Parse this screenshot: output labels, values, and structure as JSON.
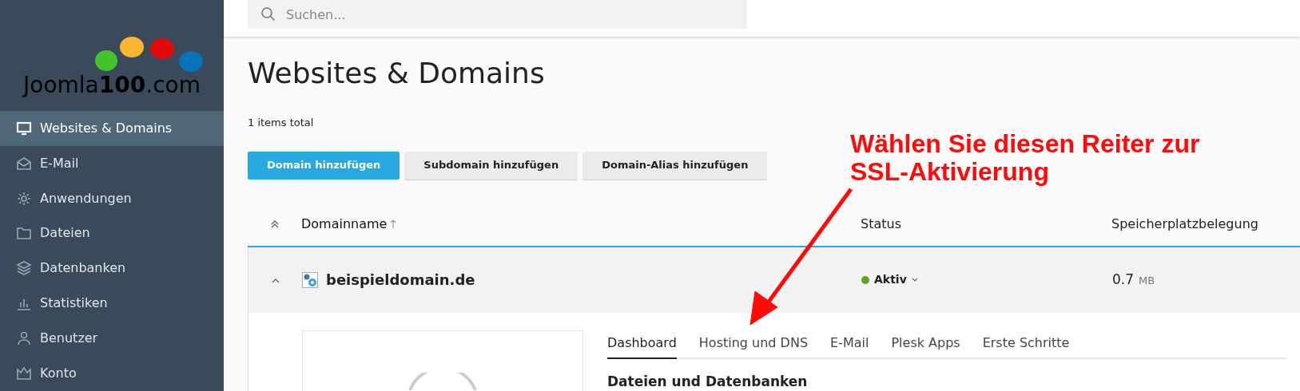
{
  "logo": {
    "text": "Joomla**100**.com"
  },
  "sidebar": {
    "items": [
      {
        "label": "Websites & Domains",
        "selected": true
      },
      {
        "label": "E-Mail",
        "selected": false
      },
      {
        "label": "Anwendungen",
        "selected": false
      },
      {
        "label": "Dateien",
        "selected": false
      },
      {
        "label": "Datenbanken",
        "selected": false
      },
      {
        "label": "Statistiken",
        "selected": false
      },
      {
        "label": "Benutzer",
        "selected": false
      },
      {
        "label": "Konto",
        "selected": false
      }
    ]
  },
  "search": {
    "placeholder": "Suchen..."
  },
  "page": {
    "title": "Websites & Domains",
    "count": "1 items total"
  },
  "buttons": [
    {
      "label": "Domain hinzufügen",
      "kind": "primary"
    },
    {
      "label": "Subdomain hinzufügen",
      "kind": "secondary"
    },
    {
      "label": "Domain-Alias hinzufügen",
      "kind": "secondary"
    }
  ],
  "table": {
    "columns": [
      {
        "label": "Domainname",
        "sorted": true
      },
      {
        "label": "Status",
        "sorted": false
      },
      {
        "label": "Speicherplatzbelegung",
        "sorted": false
      }
    ],
    "rows": [
      {
        "expanded": true,
        "domain": "beispieldomain.de",
        "status": "Aktiv",
        "color": "#5fa320",
        "usage": "0.7",
        "unit": "MB"
      }
    ]
  },
  "domain_panel": {
    "tabs": [
      {
        "label": "Dashboard",
        "selected": true
      },
      {
        "label": "Hosting und DNS",
        "selected": false
      },
      {
        "label": "E-Mail",
        "selected": false
      },
      {
        "label": "Plesk Apps",
        "selected": false
      },
      {
        "label": "Erste Schritte",
        "selected": false
      }
    ],
    "section_title": "Dateien und Datenbanken"
  },
  "annotation": {
    "text": "Wählen Sie diesen Reiter zur SSL-Aktivierung"
  }
}
